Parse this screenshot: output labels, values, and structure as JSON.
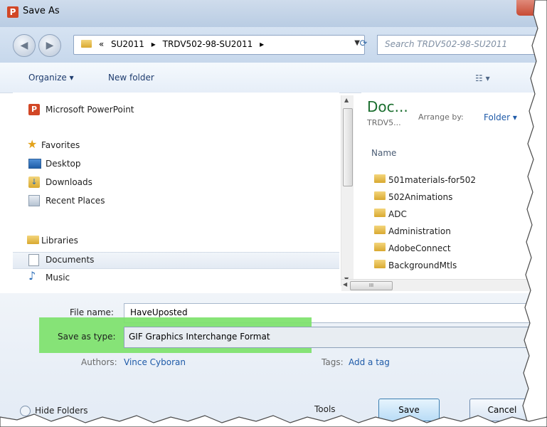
{
  "window": {
    "title": "Save As",
    "app_icon": "P"
  },
  "address": {
    "crumbs": [
      "«",
      "SU2011",
      "▸",
      "TRDV502-98-SU2011",
      "▸"
    ]
  },
  "search": {
    "placeholder": "Search TRDV502-98-SU2011"
  },
  "toolbar": {
    "organize": "Organize ▾",
    "new_folder": "New folder"
  },
  "navigation": {
    "items": [
      {
        "label": "Microsoft PowerPoint",
        "icon": "powerpoint-icon"
      },
      {
        "label": "Favorites",
        "icon": "star-icon"
      },
      {
        "label": "Desktop",
        "icon": "desktop-icon"
      },
      {
        "label": "Downloads",
        "icon": "downloads-icon"
      },
      {
        "label": "Recent Places",
        "icon": "recent-places-icon"
      },
      {
        "label": "Libraries",
        "icon": "libraries-icon"
      },
      {
        "label": "Documents",
        "icon": "documents-icon"
      },
      {
        "label": "Music",
        "icon": "music-icon"
      }
    ]
  },
  "library": {
    "title": "Doc...",
    "subtitle": "TRDV5...",
    "arrange_label": "Arrange by:",
    "arrange_value": "Folder ▾"
  },
  "files": {
    "column_header": "Name",
    "items": [
      "501materials-for502",
      "502Animations",
      "ADC",
      "Administration",
      "AdobeConnect",
      "BackgroundMtls"
    ]
  },
  "form": {
    "file_name_label": "File name:",
    "file_name_value": "HaveUposted",
    "save_type_label": "Save as type:",
    "save_type_value": "GIF Graphics Interchange Format",
    "authors_label": "Authors:",
    "authors_value": "Vince Cyboran",
    "tags_label": "Tags:",
    "tags_value": "Add a tag"
  },
  "footer": {
    "hide_folders": "Hide Folders",
    "tools": "Tools",
    "save": "Save",
    "cancel": "Cancel"
  },
  "highlight_color": "#7de26b"
}
